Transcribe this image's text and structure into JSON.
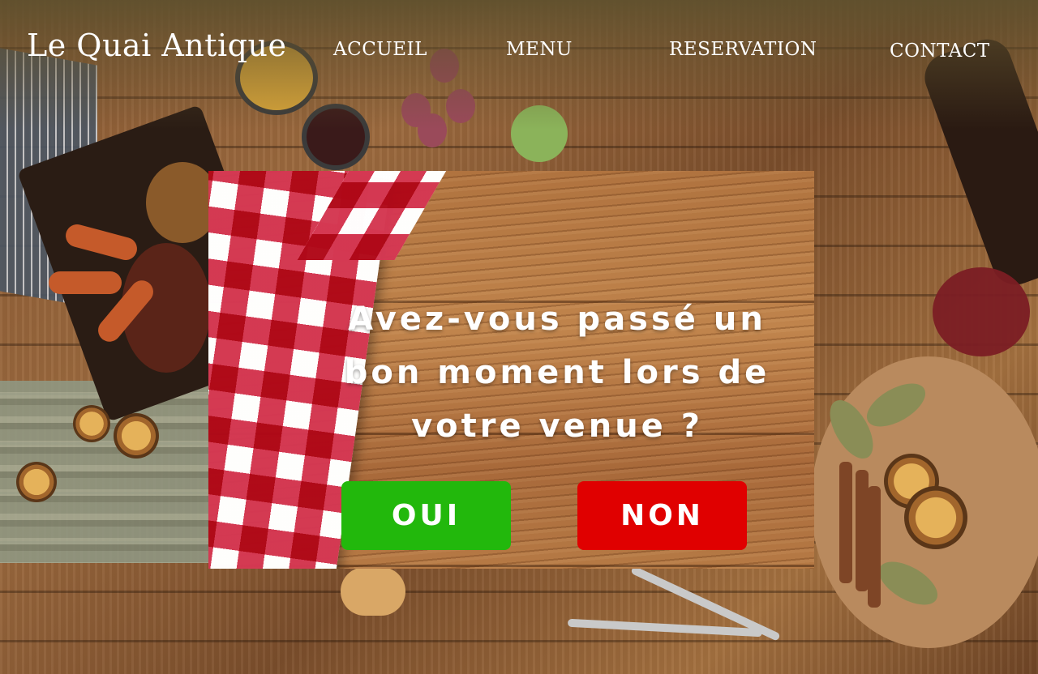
{
  "header": {
    "logo": "Le Quai Antique",
    "nav": [
      {
        "label": "ACCUEIL"
      },
      {
        "label": "MENU"
      },
      {
        "label": "RESERVATION"
      },
      {
        "label": "CONTACT"
      }
    ]
  },
  "modal": {
    "question": "Avez-vous passé un bon moment lors de votre venue ?",
    "yes_label": "OUI",
    "no_label": "NON"
  },
  "colors": {
    "yes_button": "#22b80c",
    "no_button": "#e00000",
    "header_overlay": "#5f502d",
    "text": "#ffffff"
  }
}
